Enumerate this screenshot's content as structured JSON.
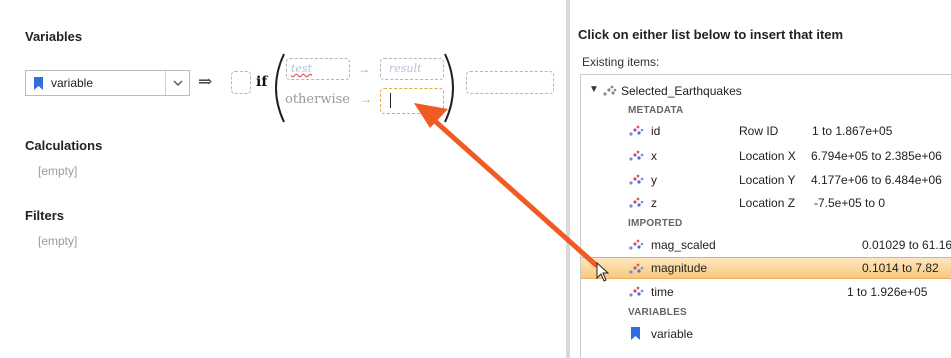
{
  "left": {
    "variables_title": "Variables",
    "variable_select_value": "variable",
    "implies_symbol": "⇒",
    "if_keyword": "if",
    "test_placeholder": "test",
    "result_placeholder": "result",
    "small_arrow": "→",
    "otherwise_label": "otherwise",
    "calculations_title": "Calculations",
    "calculations_empty": "[empty]",
    "filters_title": "Filters",
    "filters_empty": "[empty]"
  },
  "right": {
    "title": "Click on either list below to insert that item",
    "existing_label": "Existing items:",
    "root_name": "Selected_Earthquakes",
    "groups": {
      "metadata": "METADATA",
      "imported": "IMPORTED",
      "variables": "VARIABLES"
    },
    "metadata_rows": [
      {
        "name": "id",
        "desc": "Row ID",
        "range": "1 to 1.867e+05"
      },
      {
        "name": "x",
        "desc": "Location X",
        "range": "6.794e+05 to 2.385e+06"
      },
      {
        "name": "y",
        "desc": "Location Y",
        "range": "4.177e+06 to 6.484e+06"
      },
      {
        "name": "z",
        "desc": "Location Z",
        "range": "-7.5e+05 to 0"
      }
    ],
    "imported_rows": [
      {
        "name": "mag_scaled",
        "desc": "",
        "range": "0.01029 to 61.16"
      },
      {
        "name": "magnitude",
        "desc": "",
        "range": "0.1014 to 7.82"
      },
      {
        "name": "time",
        "desc": "",
        "range": "1 to 1.926e+05"
      }
    ],
    "variable_rows": [
      {
        "name": "variable"
      }
    ]
  },
  "colors": {
    "accent_arrow": "#f05a23",
    "selection": "#f8c97c",
    "bookmark": "#2f6fe0"
  },
  "icons": {
    "bookmark": "bookmark-icon",
    "dataset": "point-cloud-icon",
    "dropdown": "chevron-down-icon",
    "expand": "triangle-down-icon"
  }
}
